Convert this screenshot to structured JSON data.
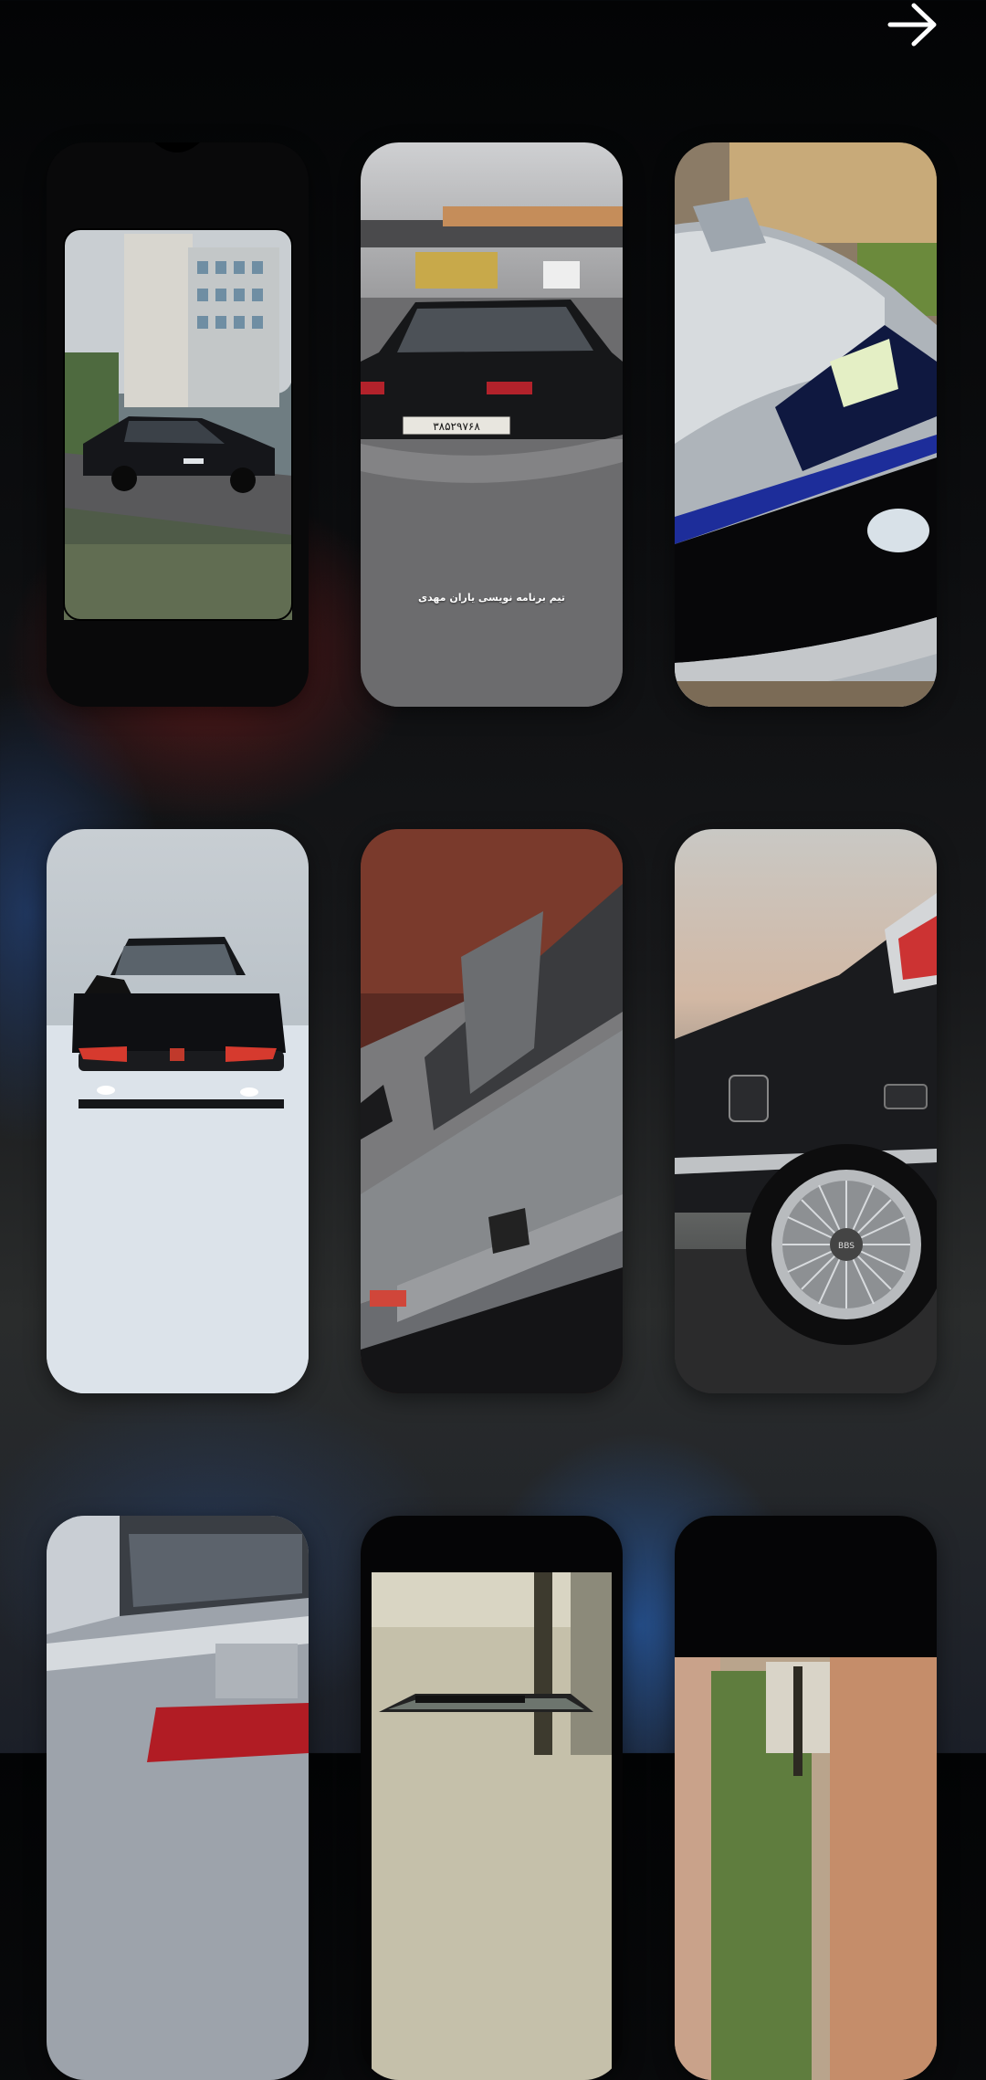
{
  "header": {
    "next_icon": "arrow-right-icon",
    "icon_color": "#ffffff"
  },
  "wallpapers": [
    {
      "subject": "black sedan parked by buildings, framed phone"
    },
    {
      "subject": "black sedan rear view on road",
      "caption": "تیم برنامه نویسی یاران مهدی",
      "plate": "۳۸۵۲۹۷۶۸"
    },
    {
      "subject": "silver sedan front headlight close-up"
    },
    {
      "subject": "black sedan front view in snow"
    },
    {
      "subject": "grey sedan hood and grille close-up"
    },
    {
      "subject": "black sedan rear wheel with mesh rim"
    },
    {
      "subject": "silver sedan rear close-up"
    },
    {
      "subject": "sedan rear with windshield badge"
    },
    {
      "subject": "street with buildings and trees"
    }
  ]
}
